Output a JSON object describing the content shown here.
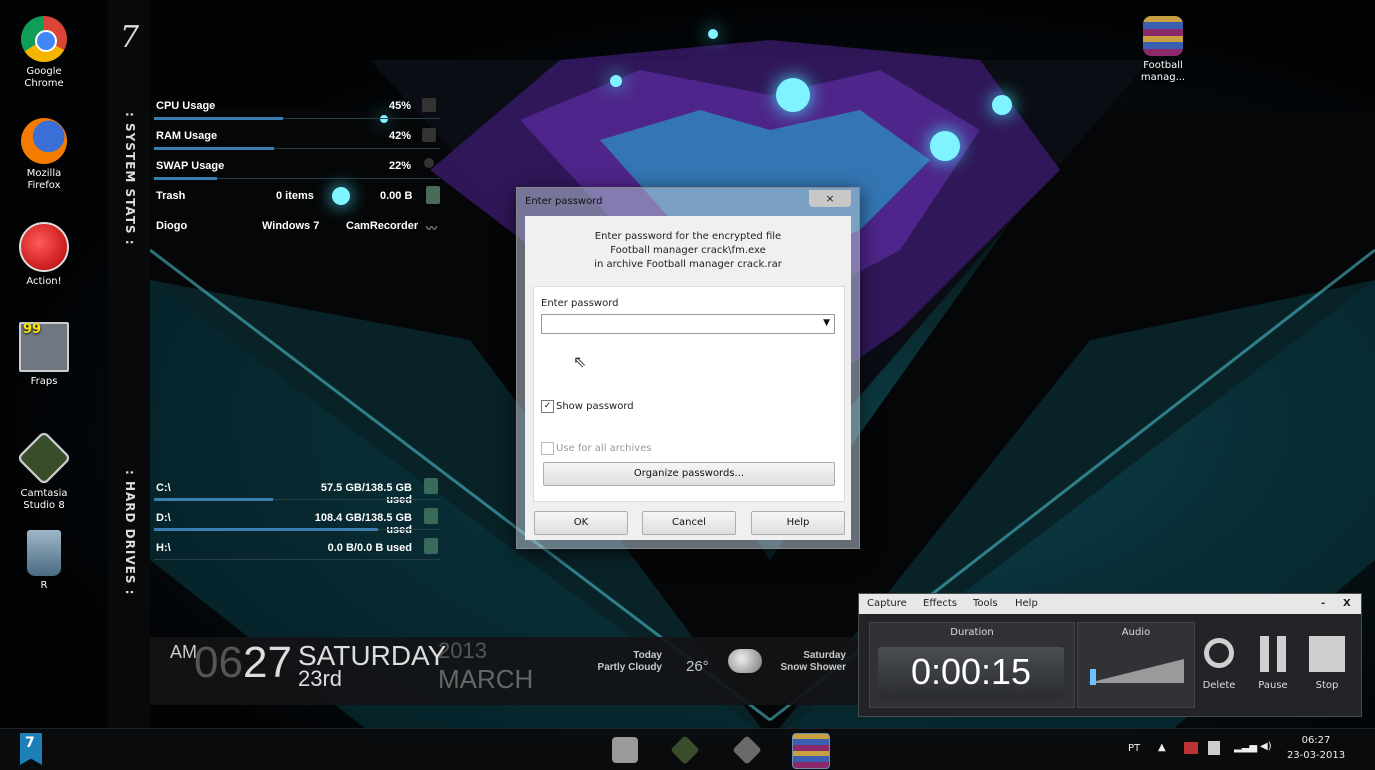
{
  "desktop_icons": [
    {
      "label": "Google\nChrome",
      "icon": "chrome-icon"
    },
    {
      "label": "Mozilla\nFirefox",
      "icon": "firefox-icon"
    },
    {
      "label": "Action!",
      "icon": "action-icon"
    },
    {
      "label": "Fraps",
      "icon": "fraps-icon",
      "badge": "99"
    },
    {
      "label": "Camtasia\nStudio 8",
      "icon": "camtasia-icon"
    },
    {
      "label": "R",
      "icon": "recycle-bin-icon"
    },
    {
      "label": "Football\nmanag...",
      "icon": "winrar-icon"
    }
  ],
  "sidebar": {
    "logo": "7",
    "system_stats_label": ": SYSTEM STATS :",
    "hard_drives_label": ": HARD DRIVES :"
  },
  "stats": [
    {
      "name": "CPU Usage",
      "value": "45%",
      "fraction": 0.45
    },
    {
      "name": "RAM Usage",
      "value": "42%",
      "fraction": 0.42
    },
    {
      "name": "SWAP Usage",
      "value": "22%",
      "fraction": 0.22
    }
  ],
  "trash": {
    "name": "Trash",
    "items": "0 items",
    "size": "0.00 B"
  },
  "user": {
    "name": "Diogo",
    "os": "Windows 7",
    "app": "CamRecorder"
  },
  "drives": [
    {
      "name": "C:\\",
      "usage": "57.5 GB/138.5 GB used",
      "fraction": 0.415
    },
    {
      "name": "D:\\",
      "usage": "108.4 GB/138.5 GB used",
      "fraction": 0.783
    },
    {
      "name": "H:\\",
      "usage": "0.0 B/0.0 B used",
      "fraction": 0
    }
  ],
  "clock": {
    "ampm": "AM",
    "hour": "06",
    "minute": "27",
    "weekday": "SATURDAY",
    "day": "23rd",
    "year": "2013",
    "month": "MARCH",
    "today_label": "Today",
    "today_cond": "Partly Cloudy",
    "temp": "26°",
    "next_day": "Saturday",
    "next_cond": "Snow Shower"
  },
  "dialog": {
    "title": "Enter password",
    "close": "×",
    "message_line1": "Enter password for the encrypted file",
    "message_line2": "Football manager crack\\fm.exe",
    "message_line3": "in archive Football manager crack.rar",
    "field_label": "Enter password",
    "password_value": "",
    "show_password_label": "Show password",
    "show_password_checked": true,
    "use_all_label": "Use for all archives",
    "organize_label": "Organize passwords...",
    "ok_label": "OK",
    "cancel_label": "Cancel",
    "help_label": "Help"
  },
  "recorder": {
    "menu": [
      "Capture",
      "Effects",
      "Tools",
      "Help"
    ],
    "minimize": "-",
    "close": "X",
    "duration_label": "Duration",
    "duration_value": "0:00:15",
    "audio_label": "Audio",
    "delete_label": "Delete",
    "pause_label": "Pause",
    "stop_label": "Stop"
  },
  "taskbar": {
    "start_label": "7",
    "language": "PT",
    "time": "06:27",
    "date": "23-03-2013"
  }
}
